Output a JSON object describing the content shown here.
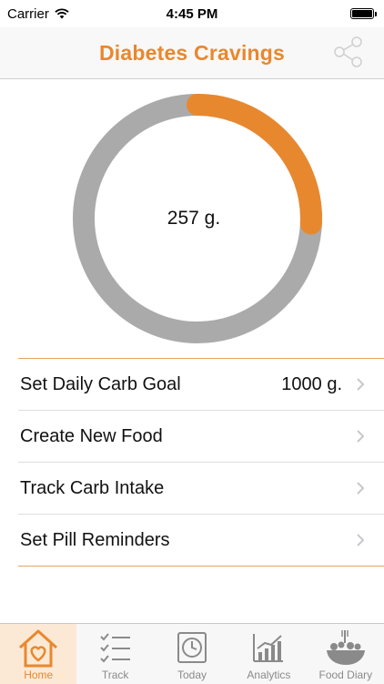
{
  "status_bar": {
    "carrier": "Carrier",
    "time": "4:45 PM"
  },
  "nav": {
    "title": "Diabetes Cravings",
    "share_icon": "share-icon"
  },
  "progress_ring": {
    "value_label": "257 g.",
    "consumed": 257,
    "goal": 1000,
    "color_fill": "#e8882e",
    "color_track": "#aaaaaa"
  },
  "menu": {
    "items": [
      {
        "label": "Set Daily Carb Goal",
        "value": "1000 g."
      },
      {
        "label": "Create New Food",
        "value": ""
      },
      {
        "label": "Track Carb Intake",
        "value": ""
      },
      {
        "label": "Set Pill Reminders",
        "value": ""
      }
    ]
  },
  "tabs": [
    {
      "label": "Home",
      "icon": "home-heart-icon",
      "active": true
    },
    {
      "label": "Track",
      "icon": "checklist-icon",
      "active": false
    },
    {
      "label": "Today",
      "icon": "clock-icon",
      "active": false
    },
    {
      "label": "Analytics",
      "icon": "bar-chart-icon",
      "active": false
    },
    {
      "label": "Food Diary",
      "icon": "food-bowl-icon",
      "active": false
    }
  ],
  "colors": {
    "accent": "#e8882e",
    "inactive": "#8a8a8a"
  }
}
